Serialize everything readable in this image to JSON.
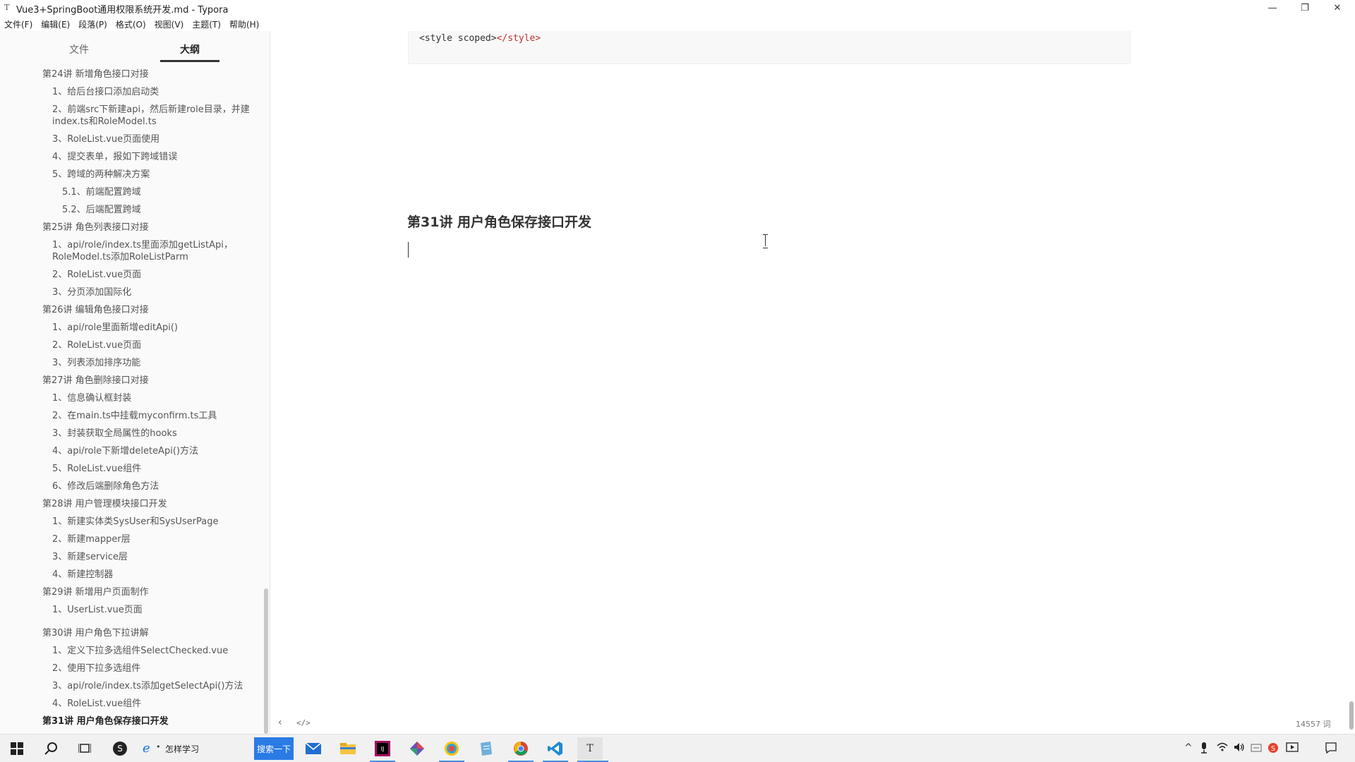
{
  "window": {
    "title": "Vue3+SpringBoot通用权限系统开发.md - Typora",
    "app_icon": "T",
    "minimize": "—",
    "maximize": "❐",
    "close": "✕"
  },
  "menu": [
    "文件(F)",
    "编辑(E)",
    "段落(P)",
    "格式(O)",
    "视图(V)",
    "主题(T)",
    "帮助(H)"
  ],
  "sidebar": {
    "tabs": {
      "files": "文件",
      "outline": "大纲"
    },
    "outline": [
      {
        "text": "第24讲 新增角色接口对接",
        "level": 1
      },
      {
        "text": "1、给后台接口添加启动类",
        "level": 2
      },
      {
        "text": "2、前端src下新建api，然后新建role目录，并建index.ts和RoleModel.ts",
        "level": 2
      },
      {
        "text": "3、RoleList.vue页面使用",
        "level": 2
      },
      {
        "text": "4、提交表单，报如下跨域错误",
        "level": 2
      },
      {
        "text": "5、跨域的两种解决方案",
        "level": 2
      },
      {
        "text": "5.1、前端配置跨域",
        "level": 3
      },
      {
        "text": "5.2、后端配置跨域",
        "level": 3
      },
      {
        "text": "第25讲 角色列表接口对接",
        "level": 1
      },
      {
        "text": "1、api/role/index.ts里面添加getListApi，RoleModel.ts添加RoleListParm",
        "level": 2
      },
      {
        "text": "2、RoleList.vue页面",
        "level": 2
      },
      {
        "text": "3、分页添加国际化",
        "level": 2
      },
      {
        "text": "第26讲 编辑角色接口对接",
        "level": 1
      },
      {
        "text": "1、api/role里面新增editApi()",
        "level": 2
      },
      {
        "text": "2、RoleList.vue页面",
        "level": 2
      },
      {
        "text": "3、列表添加排序功能",
        "level": 2
      },
      {
        "text": "第27讲 角色删除接口对接",
        "level": 1
      },
      {
        "text": "1、信息确认框封装",
        "level": 2
      },
      {
        "text": "2、在main.ts中挂载myconfirm.ts工具",
        "level": 2
      },
      {
        "text": "3、封装获取全局属性的hooks",
        "level": 2
      },
      {
        "text": "4、api/role下新增deleteApi()方法",
        "level": 2
      },
      {
        "text": "5、RoleList.vue组件",
        "level": 2
      },
      {
        "text": "6、修改后端删除角色方法",
        "level": 2
      },
      {
        "text": "第28讲 用户管理模块接口开发",
        "level": 1
      },
      {
        "text": "1、新建实体类SysUser和SysUserPage",
        "level": 2
      },
      {
        "text": "2、新建mapper层",
        "level": 2
      },
      {
        "text": "3、新建service层",
        "level": 2
      },
      {
        "text": "4、新建控制器",
        "level": 2
      },
      {
        "text": "第29讲 新增用户页面制作",
        "level": 1
      },
      {
        "text": "1、UserList.vue页面",
        "level": 2
      },
      {
        "text": "第30讲 用户角色下拉讲解",
        "level": 1
      },
      {
        "text": "1、定义下拉多选组件SelectChecked.vue",
        "level": 2
      },
      {
        "text": "2、使用下拉多选组件",
        "level": 2
      },
      {
        "text": "3、api/role/index.ts添加getSelectApi()方法",
        "level": 2
      },
      {
        "text": "4、RoleList.vue组件",
        "level": 2
      },
      {
        "text": "第31讲 用户角色保存接口开发",
        "level": 1,
        "active": true
      }
    ]
  },
  "editor": {
    "code_open": "<style scoped>",
    "code_close": "</style>",
    "heading": "第31讲 用户角色保存接口开发"
  },
  "footer": {
    "back_icon": "‹",
    "source_icon": "</>",
    "word_count": "14557 词"
  },
  "taskbar": {
    "search_text": "怎样学习",
    "search_button": "搜索一下"
  }
}
